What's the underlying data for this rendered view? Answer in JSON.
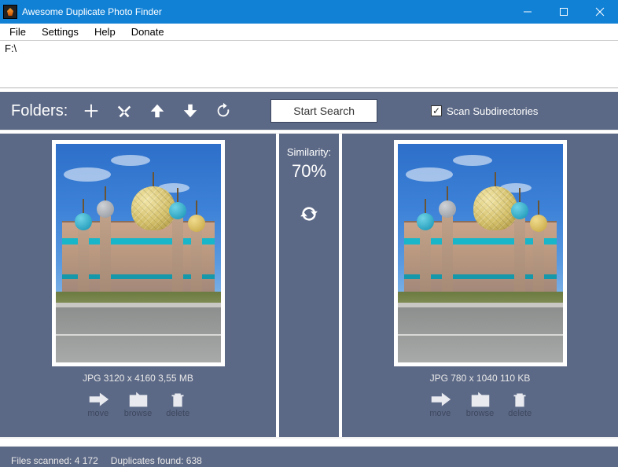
{
  "title": "Awesome Duplicate Photo Finder",
  "menu": {
    "file": "File",
    "settings": "Settings",
    "help": "Help",
    "donate": "Donate"
  },
  "path": "F:\\",
  "toolbar": {
    "folders_label": "Folders:",
    "start_search": "Start Search",
    "scan_sub": "Scan Subdirectories"
  },
  "similarity": {
    "label": "Similarity:",
    "value": "70%"
  },
  "left": {
    "meta": "JPG  3120 x 4160  3,55 MB",
    "move": "move",
    "browse": "browse",
    "delete": "delete"
  },
  "right": {
    "meta": "JPG  780 x 1040  110 KB",
    "move": "move",
    "browse": "browse",
    "delete": "delete"
  },
  "status": {
    "scanned": "Files scanned: 4 172",
    "found": "Duplicates found: 638"
  }
}
